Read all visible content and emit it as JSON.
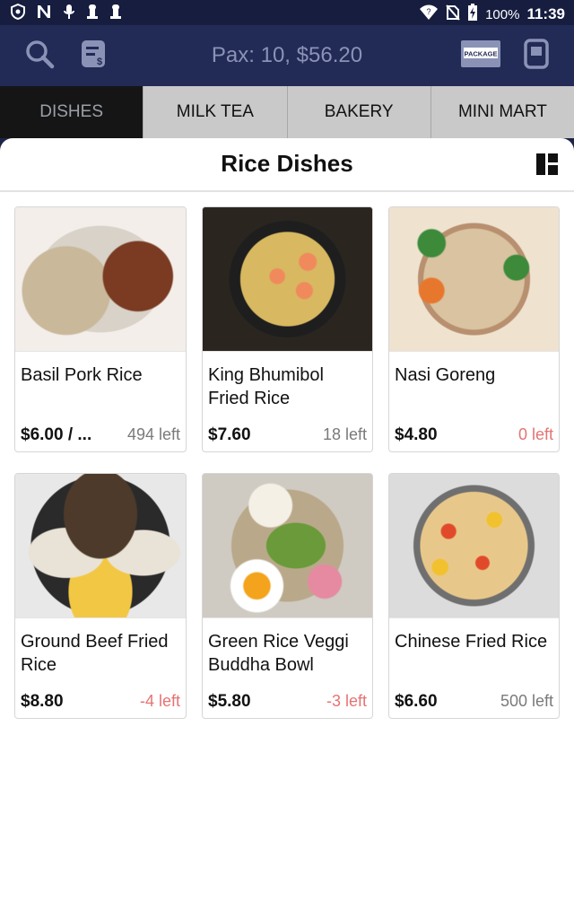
{
  "status_bar": {
    "battery": "100%",
    "time": "11:39",
    "left_icons": [
      "shield-icon",
      "n-icon",
      "microphone-icon",
      "lock-icon",
      "lock-icon-2"
    ],
    "right_icons": [
      "wifi-icon",
      "no-sim-icon",
      "battery-charging-icon"
    ]
  },
  "toolbar": {
    "pax": "Pax: 10, $56.20",
    "package_label": "PACKAGE"
  },
  "tabs": [
    {
      "label": "DISHES",
      "active": true
    },
    {
      "label": "MILK TEA",
      "active": false
    },
    {
      "label": "BAKERY",
      "active": false
    },
    {
      "label": "MINI MART",
      "active": false
    }
  ],
  "panel": {
    "title": "Rice Dishes"
  },
  "items": [
    {
      "name": "Basil Pork Rice",
      "price": "$6.00 / ...",
      "left": "494 left",
      "left_color": "#7a7a7a"
    },
    {
      "name": "King Bhumibol Fried Rice",
      "price": "$7.60",
      "left": "18 left",
      "left_color": "#7a7a7a"
    },
    {
      "name": "Nasi Goreng",
      "price": "$4.80",
      "left": "0 left",
      "left_color": "#e57373"
    },
    {
      "name": "Ground Beef Fried Rice",
      "price": "$8.80",
      "left": "-4 left",
      "left_color": "#e57373"
    },
    {
      "name": "Green Rice Veggi Buddha Bowl",
      "price": "$5.80",
      "left": "-3 left",
      "left_color": "#e57373"
    },
    {
      "name": "Chinese Fried Rice",
      "price": "$6.60",
      "left": "500 left",
      "left_color": "#7a7a7a"
    }
  ],
  "colors": {
    "status_bar": "#161d3f",
    "toolbar": "#222a56",
    "tab_active": "#151515",
    "tab_inactive": "#c9c9c9",
    "stock_negative": "#e57373",
    "stock_normal": "#7a7a7a"
  }
}
